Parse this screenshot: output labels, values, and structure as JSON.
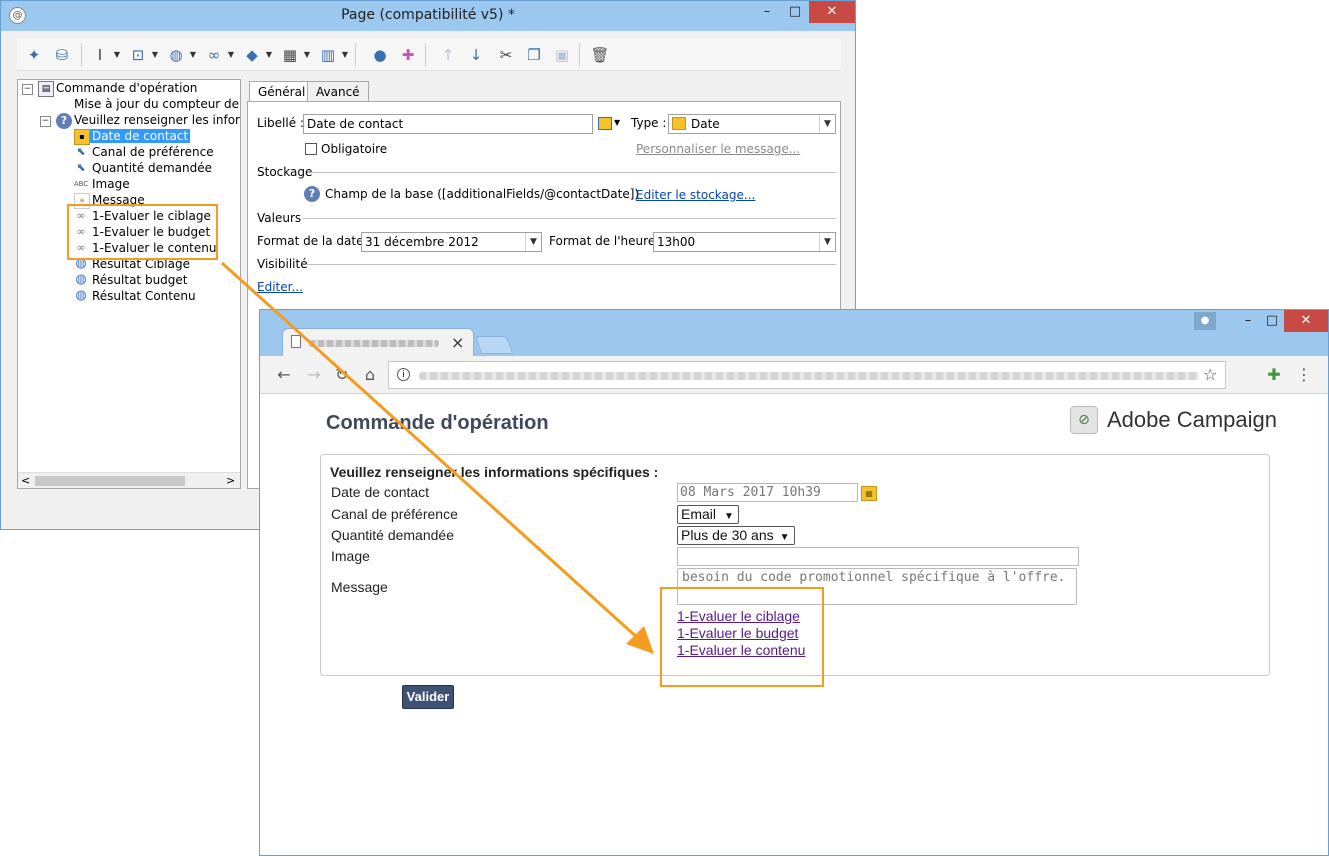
{
  "console": {
    "title": "Page (compatibilité v5) *",
    "window_buttons": {
      "minimize": "–",
      "maximize": "□",
      "close": "✕"
    },
    "tree": {
      "root": "Commande d'opération",
      "items": [
        {
          "label": "Mise à jour du compteur de pag",
          "icon": "none"
        },
        {
          "label": "Veuillez renseigner les informati",
          "icon": "question-icon"
        },
        {
          "label": "Date de contact",
          "icon": "date-field-icon",
          "selected": true
        },
        {
          "label": "Canal de préférence",
          "icon": "cursor-field-icon"
        },
        {
          "label": "Quantité demandée",
          "icon": "cursor-field-icon"
        },
        {
          "label": "Image",
          "icon": "text-field-icon",
          "icon_text": "ABC"
        },
        {
          "label": "Message",
          "icon": "text-field-icon"
        },
        {
          "label": "1-Evaluer le ciblage",
          "icon": "link-icon"
        },
        {
          "label": "1-Evaluer le budget",
          "icon": "link-icon"
        },
        {
          "label": "1-Evaluer le contenu",
          "icon": "link-icon"
        },
        {
          "label": "Résultat Ciblage",
          "icon": "globe-icon"
        },
        {
          "label": "Résultat budget",
          "icon": "globe-icon"
        },
        {
          "label": "Résultat Contenu",
          "icon": "globe-icon"
        }
      ],
      "scroll_left": "<",
      "scroll_right": ">"
    },
    "tabs": [
      "Général",
      "Avancé"
    ],
    "form": {
      "libelle_label": "Libellé :",
      "libelle_value": "Date de contact",
      "type_label": "Type :",
      "type_value": "Date",
      "obligatoire_label": "Obligatoire",
      "personnaliser_link": "Personnaliser le message...",
      "stockage_title": "Stockage",
      "stockage_text": "Champ de la base ([additionalFields/@contactDate])",
      "editer_stockage_link": "Editer le stockage...",
      "valeurs_title": "Valeurs",
      "format_date_label": "Format de la date :",
      "format_date_value": "31 décembre 2012",
      "format_heure_label": "Format de l'heure :",
      "format_heure_value": "13h00",
      "visibilite_title": "Visibilité",
      "editer_link": "Editer..."
    }
  },
  "browser": {
    "tab_close": "×",
    "page": {
      "title": "Commande d'opération",
      "brand": "Adobe Campaign",
      "section_title": "Veuillez renseigner les informations spécifiques :",
      "fields": [
        {
          "label": "Date de contact",
          "value": "08 Mars 2017 10h39"
        },
        {
          "label": "Canal de préférence",
          "value": "Email"
        },
        {
          "label": "Quantité demandée",
          "value": "Plus de 30 ans"
        },
        {
          "label": "Image",
          "value": ""
        },
        {
          "label": "Message",
          "value": "besoin du code promotionnel spécifique à l'offre."
        }
      ],
      "links": [
        "1-Evaluer le ciblage",
        "1-Evaluer le budget",
        "1-Evaluer le contenu"
      ],
      "submit": "Valider"
    }
  },
  "colors": {
    "highlight": "#f39c1f",
    "selection": "#3399ff",
    "titlebar": "#9cc8f0",
    "button": "#3d5276"
  }
}
